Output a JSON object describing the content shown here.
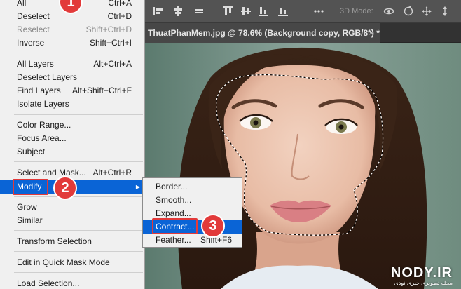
{
  "options_bar": {
    "mode_label": "3D Mode:",
    "icons": [
      "align-left-icon",
      "align-center-icon",
      "align-right-icon",
      "align-top-icon",
      "align-middle-icon",
      "align-bottom-icon",
      "more-icon",
      "orbit-3d-icon",
      "roll-3d-icon",
      "pan-3d-icon",
      "slide-3d-icon",
      "scale-3d-icon"
    ]
  },
  "document_tab": {
    "title": "ThuatPhanMem.jpg @ 78.6% (Background copy, RGB/8*) *",
    "close_glyph": "×"
  },
  "select_menu": {
    "items": [
      {
        "label": "All",
        "shortcut": "Ctrl+A",
        "disabled": false
      },
      {
        "label": "Deselect",
        "shortcut": "Ctrl+D",
        "disabled": false
      },
      {
        "label": "Reselect",
        "shortcut": "Shift+Ctrl+D",
        "disabled": true
      },
      {
        "label": "Inverse",
        "shortcut": "Shift+Ctrl+I",
        "disabled": false
      },
      {
        "label": "All Layers",
        "shortcut": "Alt+Ctrl+A",
        "disabled": false
      },
      {
        "label": "Deselect Layers",
        "shortcut": "",
        "disabled": false
      },
      {
        "label": "Find Layers",
        "shortcut": "Alt+Shift+Ctrl+F",
        "disabled": false
      },
      {
        "label": "Isolate Layers",
        "shortcut": "",
        "disabled": false
      },
      {
        "label": "Color Range...",
        "shortcut": "",
        "disabled": false
      },
      {
        "label": "Focus Area...",
        "shortcut": "",
        "disabled": false
      },
      {
        "label": "Subject",
        "shortcut": "",
        "disabled": false
      },
      {
        "label": "Select and Mask...",
        "shortcut": "Alt+Ctrl+R",
        "disabled": false
      },
      {
        "label": "Modify",
        "shortcut": "",
        "disabled": false
      },
      {
        "label": "Grow",
        "shortcut": "",
        "disabled": false
      },
      {
        "label": "Similar",
        "shortcut": "",
        "disabled": false
      },
      {
        "label": "Transform Selection",
        "shortcut": "",
        "disabled": false
      },
      {
        "label": "Edit in Quick Mask Mode",
        "shortcut": "",
        "disabled": false
      },
      {
        "label": "Load Selection...",
        "shortcut": "",
        "disabled": false
      }
    ]
  },
  "modify_submenu": {
    "items": [
      {
        "label": "Border...",
        "shortcut": ""
      },
      {
        "label": "Smooth...",
        "shortcut": ""
      },
      {
        "label": "Expand...",
        "shortcut": ""
      },
      {
        "label": "Contract...",
        "shortcut": ""
      },
      {
        "label": "Feather...",
        "shortcut": "Shift+F6"
      }
    ]
  },
  "callouts": {
    "step1": "1",
    "step2": "2",
    "step3": "3"
  },
  "watermark": {
    "logo": "NODY.IR",
    "subtitle": "مجله تصویری خبری نودی"
  },
  "colors": {
    "menu_highlight": "#0a64d6",
    "callout": "#e23a3a",
    "options_bar": "#535353",
    "tab_bar": "#323232"
  }
}
